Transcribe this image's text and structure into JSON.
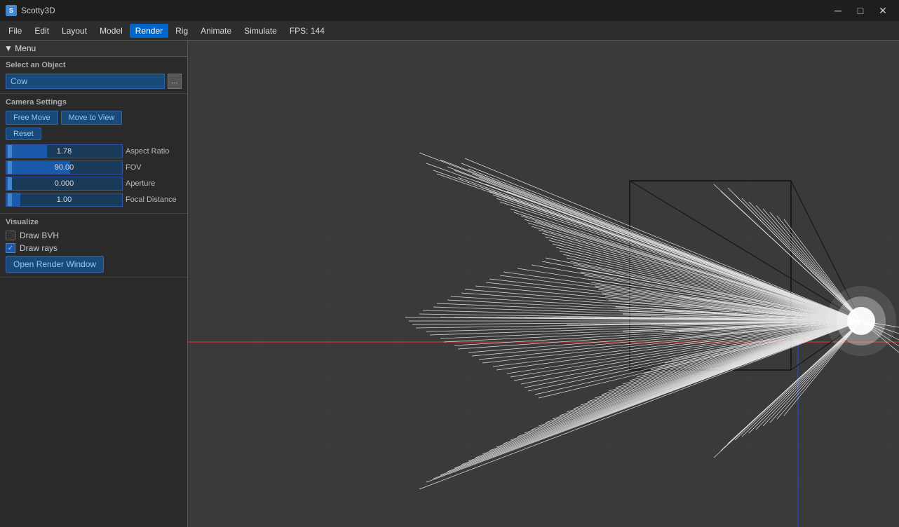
{
  "titlebar": {
    "title": "Scotty3D",
    "icon_label": "S",
    "min_btn": "─",
    "max_btn": "□",
    "close_btn": "✕"
  },
  "menubar": {
    "items": [
      "File",
      "Edit",
      "Layout",
      "Model",
      "Render",
      "Rig",
      "Animate",
      "Simulate"
    ],
    "active_item": "Render",
    "fps_label": "FPS: 144"
  },
  "left_panel": {
    "menu_label": "▼ Menu",
    "select_section": {
      "title": "Select an Object",
      "object_name": "Cow",
      "btn_label": "…"
    },
    "camera_section": {
      "title": "Camera Settings",
      "free_move_label": "Free Move",
      "move_to_view_label": "Move to View",
      "reset_label": "Reset",
      "sliders": [
        {
          "value": "1.78",
          "label": "Aspect Ratio",
          "fill_pct": 35
        },
        {
          "value": "90.00",
          "label": "FOV",
          "fill_pct": 55
        },
        {
          "value": "0.000",
          "label": "Aperture",
          "fill_pct": 5
        },
        {
          "value": "1.00",
          "label": "Focal Distance",
          "fill_pct": 12
        }
      ]
    },
    "visualize_section": {
      "title": "Visualize",
      "checkboxes": [
        {
          "label": "Draw BVH",
          "checked": false
        },
        {
          "label": "Draw rays",
          "checked": true
        }
      ],
      "render_btn_label": "Open Render Window"
    }
  }
}
